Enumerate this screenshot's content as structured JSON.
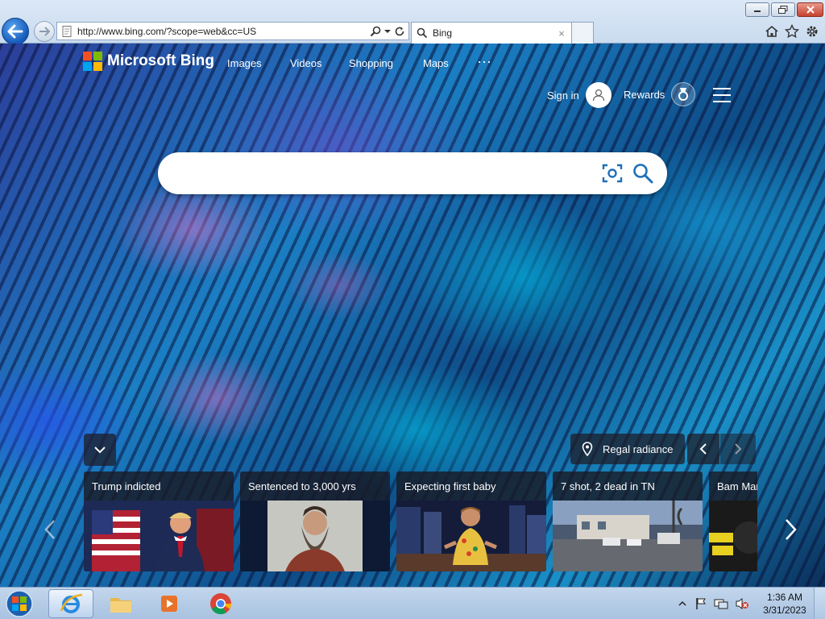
{
  "browser": {
    "address_url": "http://www.bing.com/?scope=web&cc=US",
    "tab_title": "Bing",
    "tab_close": "×"
  },
  "header": {
    "logo_text": "Microsoft Bing",
    "nav": [
      "Images",
      "Videos",
      "Shopping",
      "Maps"
    ],
    "more": "···",
    "sign_in": "Sign in",
    "rewards": "Rewards"
  },
  "search": {
    "value": "",
    "placeholder": ""
  },
  "image_of_day": {
    "title": "Regal radiance"
  },
  "news": [
    {
      "headline": "Trump indicted"
    },
    {
      "headline": "Sentenced to 3,000 yrs"
    },
    {
      "headline": "Expecting first baby"
    },
    {
      "headline": "7 shot, 2 dead in TN"
    },
    {
      "headline": "Bam Mar"
    }
  ],
  "taskbar": {
    "time": "1:36 AM",
    "date": "3/31/2023"
  },
  "colors": {
    "browser_back": "#1459b8",
    "ms_red": "#f25022",
    "ms_green": "#7fba00",
    "ms_blue": "#00a4ef",
    "ms_yellow": "#ffb900",
    "search_icon": "#1e6fb8"
  },
  "icons": {
    "back": "arrow-left-icon",
    "forward": "arrow-right-icon",
    "search": "magnifier-icon",
    "refresh": "refresh-icon",
    "home": "home-icon",
    "favorites": "star-icon",
    "settings": "gear-icon",
    "location": "location-pin-icon",
    "visual_search": "camera-scan-icon",
    "medal": "medal-icon"
  }
}
